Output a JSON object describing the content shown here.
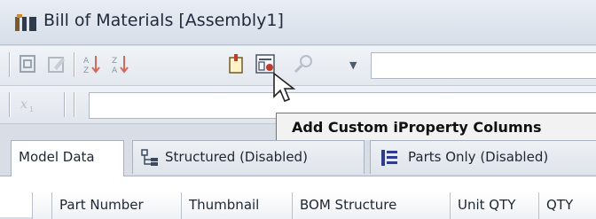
{
  "window": {
    "title": "Bill of Materials [Assembly1]",
    "title_icon": "bom-icon"
  },
  "toolbar": {
    "icons": [
      "export-icon",
      "edit-icon",
      "sort-ascending-icon",
      "sort-descending-icon",
      "choose-columns-icon",
      "add-custom-iproperty-columns-icon",
      "find-icon"
    ],
    "find_dropdown_icon": "chevron-down-icon",
    "filter_icon": "formula-icon"
  },
  "tooltip": {
    "text": "Add Custom iProperty Columns"
  },
  "tabs": [
    {
      "label": "Model Data",
      "active": true
    },
    {
      "label": "Structured (Disabled)",
      "icon": "structured-icon"
    },
    {
      "label": "Parts Only (Disabled)",
      "icon": "parts-only-icon"
    }
  ],
  "table": {
    "columns": [
      "Part Number",
      "Thumbnail",
      "BOM Structure",
      "Unit QTY",
      "QTY"
    ]
  },
  "colors": {
    "accent_red": "#c23a2b",
    "tooltip_bg": "#f2f2f2"
  }
}
